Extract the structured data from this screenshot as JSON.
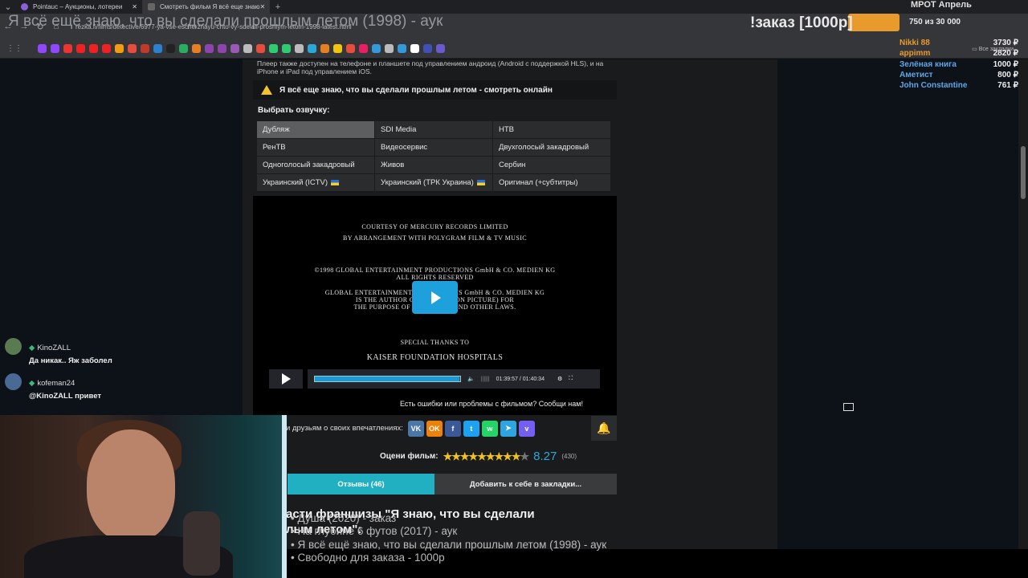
{
  "browser": {
    "tabs": [
      {
        "label": "Pointauc – Аукционы, лотереи",
        "color": "#8a62d6"
      },
      {
        "label": "Смотреть фильм Я всё еще знаю",
        "color": "#666666"
      }
    ],
    "url": "rezka.fi/films/detective/6977-ya-vse-esche-znayu-chto-vy-sdelali-proshlym-letom-1998-latest.html",
    "bookmarks_label": "Все закладки"
  },
  "stream_overlay": {
    "title": "Я всё ещё знаю, что вы сделали прошлым летом (1998) - аук",
    "order_text": "!заказ [1000р]",
    "mrot_label": "МРОТ Апрель",
    "mrot_progress": "750  из 30 000",
    "donations": [
      {
        "name": "Nikki 88",
        "amount": "3730 ₽",
        "color": "#e89a2c"
      },
      {
        "name": "appimm",
        "amount": "2820 ₽",
        "color": "#e89a2c"
      },
      {
        "name": "Зелёная книга",
        "amount": "1000 ₽",
        "color": "#5fa7e8"
      },
      {
        "name": "Аметист",
        "amount": "800 ₽",
        "color": "#5fa7e8"
      },
      {
        "name": "John Constantine",
        "amount": "761 ₽",
        "color": "#5fa7e8"
      }
    ],
    "franchise_heading": "асти франшизы \"Я знаю, что вы сделали\nлым летом\":",
    "queue": [
      "• Душа (2020) - заказ",
      "• На глубине 6 футов (2017) - аук",
      "• Я всё ещё знаю, что вы сделали прошлым летом (1998) - аук",
      "• Свободно для заказа - 1000р"
    ]
  },
  "chat": [
    {
      "user": "KinoZALL",
      "message": "Да никак.. Яж заболел",
      "avatar_color": "#5a7a52"
    },
    {
      "user": "kofeman24",
      "message": "@KinoZALL привет",
      "avatar_color": "#4a6a96"
    }
  ],
  "page": {
    "player_note": "Плеер также доступен на телефоне и планшете под управлением андроид (Android с поддержкой HLS), и на iPhone и iPad под управлением iOS.",
    "watch_title": "Я всё еще знаю, что вы сделали прошлым летом - смотреть онлайн",
    "choose_dub": "Выбрать озвучку:",
    "dubs": [
      {
        "label": "Дубляж",
        "selected": true,
        "flag": false
      },
      {
        "label": "SDI Media",
        "selected": false,
        "flag": false
      },
      {
        "label": "НТВ",
        "selected": false,
        "flag": false
      },
      {
        "label": "РенТВ",
        "selected": false,
        "flag": false
      },
      {
        "label": "Видеосервис",
        "selected": false,
        "flag": false
      },
      {
        "label": "Двухголосый закадровый",
        "selected": false,
        "flag": false
      },
      {
        "label": "Одноголосый закадровый",
        "selected": false,
        "flag": false
      },
      {
        "label": "Живов",
        "selected": false,
        "flag": false
      },
      {
        "label": "Сербин",
        "selected": false,
        "flag": false
      },
      {
        "label": "Украинский (ICTV)",
        "selected": false,
        "flag": true
      },
      {
        "label": "Украинский (ТРК Украина)",
        "selected": false,
        "flag": true
      },
      {
        "label": "Оригинал (+субтитры)",
        "selected": false,
        "flag": false
      }
    ],
    "credits": [
      "COURTESY OF MERCURY RECORDS LIMITED",
      "BY ARRANGEMENT WITH POLYGRAM FILM & TV MUSIC",
      "©1998 GLOBAL ENTERTAINMENT PRODUCTIONS GmbH & CO. MEDIEN KG",
      "ALL RIGHTS RESERVED",
      "GLOBAL ENTERTAINMENT PRODUCTIONS GmbH & CO. MEDIEN KG",
      "IS THE AUTHOR OF THIS MOTION PICTURE) FOR",
      "THE PURPOSE OF COPYRIGHT AND OTHER LAWS.",
      "SPECIAL THANKS TO",
      "KAISER FOUNDATION HOSPITALS"
    ],
    "time": "01:39:57 / 01:40:34",
    "progress": 0.994,
    "report_text": "Есть ошибки или проблемы с фильмом? Сообщи нам!",
    "share_text": "и друзьям о своих впечатлениях:",
    "share_icons": [
      {
        "name": "vk-icon",
        "glyph": "VK",
        "color": "#4a76a8"
      },
      {
        "name": "ok-icon",
        "glyph": "OK",
        "color": "#ee8208"
      },
      {
        "name": "facebook-icon",
        "glyph": "f",
        "color": "#3b5998"
      },
      {
        "name": "twitter-icon",
        "glyph": "t",
        "color": "#1da1f2"
      },
      {
        "name": "whatsapp-icon",
        "glyph": "w",
        "color": "#25d366"
      },
      {
        "name": "telegram-icon",
        "glyph": "➤",
        "color": "#2ca5e0"
      },
      {
        "name": "viber-icon",
        "glyph": "v",
        "color": "#7360f2"
      }
    ],
    "rate_label": "Оцени фильм:",
    "rating_value": "8.27",
    "rating_votes": "(430)",
    "rating_stars_filled": 8.5,
    "tab_reviews": "Отзывы (46)",
    "tab_bookmarks": "Добавить к себе в закладки..."
  }
}
